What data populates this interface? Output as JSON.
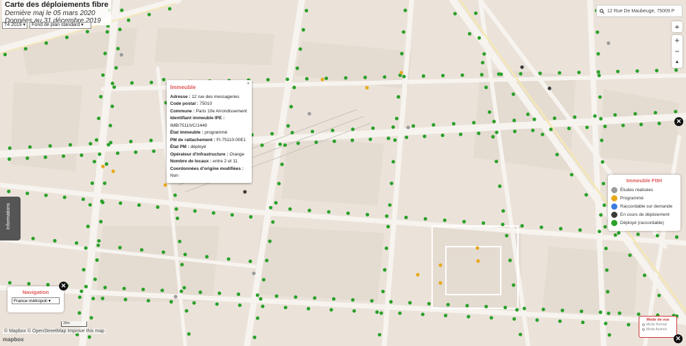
{
  "header": {
    "title": "Carte des déploiements fibre",
    "update_line": "Dernière maj le 05 mars 2020",
    "data_line": "Données au 31 décembre 2019"
  },
  "filters": {
    "quarter": "T4 2019 ▾",
    "basemap": "Fond de plan standard ▾"
  },
  "search": {
    "value": "12 Rue De Maubeuge, 75009 P"
  },
  "controls": {
    "locate": "⌖",
    "zoom_in": "+",
    "zoom_out": "−",
    "compass": "▲",
    "close": "✕"
  },
  "popup": {
    "title": "Immeuble",
    "close": "×",
    "fields": [
      {
        "label": "Adresse :",
        "value": "12 rue des messageries"
      },
      {
        "label": "Code postal :",
        "value": "75010"
      },
      {
        "label": "Commune :",
        "value": "Paris 10e Arrondissement"
      },
      {
        "label": "Identifiant immeuble IPE :",
        "value": "IMB/75110/C/1449"
      },
      {
        "label": "État immeuble :",
        "value": "programmé"
      },
      {
        "label": "PM de rattachement :",
        "value": "FI-75110-00E1"
      },
      {
        "label": "État PM :",
        "value": "déployé"
      },
      {
        "label": "Opérateur d'infrastructure :",
        "value": "Orange"
      },
      {
        "label": "Nombre de locaux :",
        "value": "entre 2 et 11"
      },
      {
        "label": "Coordonnées d'origine modifiées :",
        "value": "Non"
      }
    ]
  },
  "legend": {
    "title": "Immeuble FttH",
    "items": [
      {
        "label": "Études réalisées",
        "color": "#9a9a9a"
      },
      {
        "label": "Programmé",
        "color": "#e6a91b"
      },
      {
        "label": "Raccordable sur demande",
        "color": "#3b7be0"
      },
      {
        "label": "En cours de déploiement",
        "color": "#3a3a3a"
      },
      {
        "label": "Déployé (raccordable)",
        "color": "#2aa12a"
      }
    ]
  },
  "side_tab": {
    "label": "Informations"
  },
  "navigation": {
    "title": "Navigation",
    "selected": "France métropoli ▾"
  },
  "view_mode": {
    "title": "Mode de vue",
    "options": [
      "Mode Normal",
      "Mode Avancé"
    ]
  },
  "scale": {
    "label": "30m"
  },
  "attribution": {
    "text": "© Mapbox © OpenStreetMap Improve this map",
    "logo": "mapbox"
  },
  "colors": {
    "deployed": "#2aa12a",
    "scheduled": "#e6a91b",
    "studied": "#9a9a9a",
    "in_progress": "#3a3a3a",
    "accent_red": "#e05a5a"
  }
}
